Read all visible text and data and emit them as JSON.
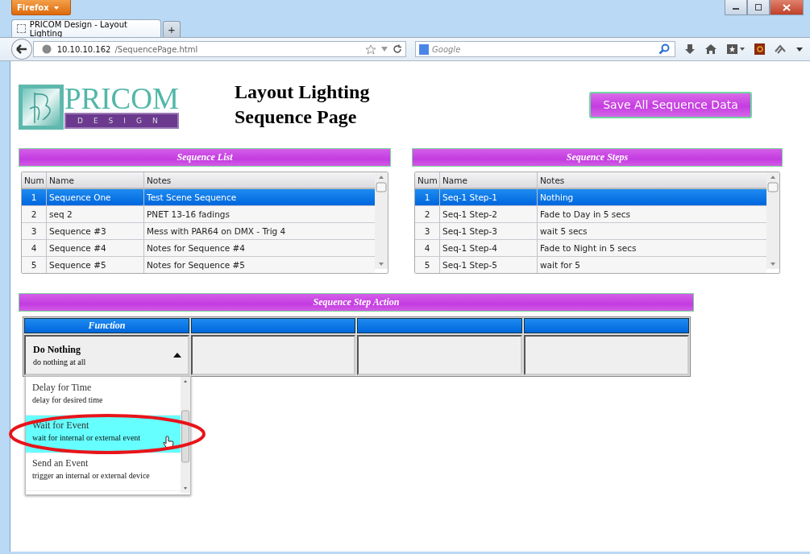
{
  "browser": {
    "menu_button": "Firefox",
    "tab_title": "PRICOM Design - Layout Lighting",
    "new_tab": "+",
    "url_host": "10.10.10.162",
    "url_path": "/SequencePage.html",
    "search_placeholder": "Google"
  },
  "header": {
    "logo_name": "PRICOM",
    "logo_subtitle": "DESIGN",
    "title_lines": [
      "Layout Lighting",
      "Sequence Page"
    ],
    "save_button": "Save All Sequence Data"
  },
  "sequence_list": {
    "title": "Sequence List",
    "columns": [
      "Num",
      "Name",
      "Notes"
    ],
    "rows": [
      {
        "num": "1",
        "name": "Sequence One",
        "notes": "Test Scene Sequence",
        "selected": true
      },
      {
        "num": "2",
        "name": "seq 2",
        "notes": "PNET 13-16 fadings",
        "selected": false
      },
      {
        "num": "3",
        "name": "Sequence #3",
        "notes": "Mess with PAR64 on DMX - Trig 4",
        "selected": false
      },
      {
        "num": "4",
        "name": "Sequence #4",
        "notes": "Notes for Sequence #4",
        "selected": false
      },
      {
        "num": "5",
        "name": "Sequence #5",
        "notes": "Notes for Sequence #5",
        "selected": false
      }
    ]
  },
  "sequence_steps": {
    "title": "Sequence Steps",
    "columns": [
      "Num",
      "Name",
      "Notes"
    ],
    "rows": [
      {
        "num": "1",
        "name": "Seq-1 Step-1",
        "notes": "Nothing",
        "selected": true
      },
      {
        "num": "2",
        "name": "Seq-1 Step-2",
        "notes": "Fade to Day in 5 secs",
        "selected": false
      },
      {
        "num": "3",
        "name": "Seq-1 Step-3",
        "notes": "wait 5 secs",
        "selected": false
      },
      {
        "num": "4",
        "name": "Seq-1 Step-4",
        "notes": "Fade to Night in 5 secs",
        "selected": false
      },
      {
        "num": "5",
        "name": "Seq-1 Step-5",
        "notes": "wait for 5",
        "selected": false
      }
    ]
  },
  "step_action": {
    "title": "Sequence Step Action",
    "function_column": "Function",
    "function_select": {
      "value": "Do Nothing",
      "description": "do nothing at all",
      "expanded": true
    },
    "options": [
      {
        "label": "Delay for Time",
        "description": "delay for desired time",
        "highlighted": false,
        "circled": false
      },
      {
        "label": "Wait for Event",
        "description": "wait for internal or external event",
        "highlighted": true,
        "circled": true
      },
      {
        "label": "Send an Event",
        "description": "trigger an internal or external device",
        "highlighted": false,
        "circled": false
      }
    ]
  }
}
